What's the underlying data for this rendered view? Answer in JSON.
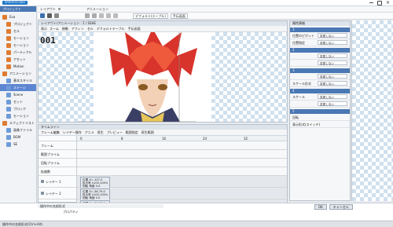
{
  "app": {
    "logo_text": "SPRITESTUDIO",
    "window_controls": [
      "min",
      "max",
      "close"
    ]
  },
  "left_panel": {
    "title": "プロジェクト",
    "tree": [
      {
        "label": "Eva",
        "indent": 0,
        "icon": "folder-icon"
      },
      {
        "label": "プロジェクト",
        "indent": 1,
        "icon": "folder-icon"
      },
      {
        "label": "セル",
        "indent": 1,
        "icon": "folder-icon"
      },
      {
        "label": "モーション",
        "indent": 1,
        "icon": "folder-icon"
      },
      {
        "label": "モーション",
        "indent": 1,
        "icon": "folder-icon"
      },
      {
        "label": "パーティクル",
        "indent": 1,
        "icon": "folder-icon"
      },
      {
        "label": "アセット",
        "indent": 1,
        "icon": "folder-icon"
      },
      {
        "label": "Motion",
        "indent": 1,
        "icon": "folder-icon"
      },
      {
        "label": "アニメーション",
        "indent": 0,
        "icon": "folder-icon"
      },
      {
        "label": "基本スタイル",
        "indent": 1,
        "icon": "file-icon"
      },
      {
        "label": "ステージ",
        "indent": 1,
        "icon": "file-icon",
        "selected": true
      },
      {
        "label": "Scene",
        "indent": 1,
        "icon": "file-icon"
      },
      {
        "label": "セット",
        "indent": 1,
        "icon": "file-icon"
      },
      {
        "label": "ブロック",
        "indent": 1,
        "icon": "file-icon"
      },
      {
        "label": "モーション",
        "indent": 1,
        "icon": "file-icon"
      },
      {
        "label": "エフェクトリスト",
        "indent": 0,
        "icon": "folder-icon"
      },
      {
        "label": "画像ファイル",
        "indent": 1,
        "icon": "file-icon"
      },
      {
        "label": "BGM",
        "indent": 1,
        "icon": "file-icon"
      },
      {
        "label": "SE",
        "indent": 1,
        "icon": "file-icon"
      }
    ]
  },
  "top_toolbar": {
    "doc_label": "レイアウト",
    "tab_label": "アニメーション",
    "dropdown_value": "デフォルト(テーブル)",
    "extra_label": "手伝画面"
  },
  "canvas": {
    "title": "レイアウト/アニメーション : 1 / SSAE",
    "toolbar_left": "表示",
    "toolbar_items": [
      "ズーム",
      "移動",
      "アフィン",
      "セル",
      "デフォルトテーブル",
      "手伝画面"
    ],
    "frame_number": "001"
  },
  "timeline": {
    "title": "タイムライン",
    "tabs": [
      "フレーム編集",
      "レイヤー操作",
      "アニメ",
      "再生",
      "プレビュー",
      "範囲指定",
      "再生範囲"
    ],
    "ruler": [
      "0",
      "8",
      "16",
      "24",
      "32"
    ],
    "tracks": [
      {
        "label": "フレーム"
      },
      {
        "label": "範囲プライム"
      },
      {
        "label": "回転プライム"
      },
      {
        "label": "拡縮数"
      },
      {
        "label": "レイヤー 1",
        "has_key": true
      },
      {
        "label": "レイヤー 2",
        "has_key": true
      },
      {
        "label": "レイヤー 3",
        "has_key": true
      }
    ],
    "key_cards": [
      [
        "位置 X=-107,0",
        "拡大率 x100,100%",
        "回転 角度 0.0"
      ],
      [
        "位置 X=-36,79,0",
        "拡大率 x100,100%",
        "回転 角度 0.0"
      ],
      [
        "位置 X=-36,86,0",
        "拡大率 x100,100%",
        "回転 角度 0.0"
      ]
    ]
  },
  "right_panel": {
    "title": "属性情報",
    "sections": [
      {
        "header": "1",
        "rows": [
          {
            "label": "位置のピボット",
            "value": "変更しない"
          },
          {
            "label": "位置指定",
            "value": "変更しない"
          }
        ]
      },
      {
        "header": "2",
        "rows": [
          {
            "label": "",
            "value": "変更しない"
          },
          {
            "label": "",
            "value": "変更しない"
          }
        ]
      },
      {
        "header": "3",
        "rows": [
          {
            "label": "",
            "value": "変更しない"
          },
          {
            "label": "スケール形式",
            "value": "変更しない"
          }
        ]
      },
      {
        "header": "4",
        "rows": [
          {
            "label": "スケール",
            "value": "変更しない"
          },
          {
            "label": "",
            "value": "変更しない"
          }
        ]
      },
      {
        "header": "5",
        "rows": [
          {
            "label": "回転",
            "value": ""
          },
          {
            "label": "表示形式(スイッチ)",
            "value": ""
          }
        ]
      }
    ]
  },
  "bottom": {
    "left_title": "操作中の名前形式",
    "left_label": "操作中の名前形式",
    "right_label": "プロパティ",
    "buttons": [
      "OK",
      "キャンセル"
    ],
    "status": "操作中の名前形式(Ctrl+Alt)"
  },
  "colors": {
    "accent": "#4a78b4",
    "tree_icon": "#e07c32",
    "selected": "#5d86d2"
  }
}
